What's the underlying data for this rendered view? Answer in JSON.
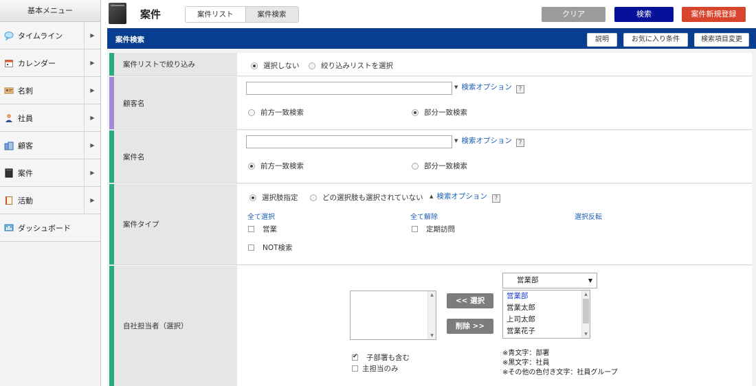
{
  "sidebar": {
    "header": "基本メニュー",
    "items": [
      {
        "label": "タイムライン",
        "icon": "speech-bubble-icon",
        "has_arrow": true
      },
      {
        "label": "カレンダー",
        "icon": "calendar-icon",
        "has_arrow": true
      },
      {
        "label": "名刺",
        "icon": "business-card-icon",
        "has_arrow": true
      },
      {
        "label": "社員",
        "icon": "person-icon",
        "has_arrow": true
      },
      {
        "label": "顧客",
        "icon": "building-icon",
        "has_arrow": true
      },
      {
        "label": "案件",
        "icon": "case-icon",
        "has_arrow": true
      },
      {
        "label": "活動",
        "icon": "notebook-icon",
        "has_arrow": true
      },
      {
        "label": "ダッシュボード",
        "icon": "dashboard-icon",
        "has_arrow": false
      }
    ],
    "arrow_glyph": "▶"
  },
  "header": {
    "title": "案件",
    "tabs": [
      {
        "label": "案件リスト",
        "active": false
      },
      {
        "label": "案件検索",
        "active": true
      }
    ],
    "buttons": {
      "clear": "クリア",
      "search": "検索",
      "new": "案件新規登録"
    },
    "colors": {
      "clear": "#9c9c9c",
      "search": "#06119a",
      "new": "#d9442c"
    }
  },
  "bar": {
    "title": "案件検索",
    "help": "説明",
    "favorite": "お気に入り条件",
    "change": "検索項目変更",
    "color": "#083e8f"
  },
  "form": {
    "list_filter": {
      "label": "案件リストで絞り込み",
      "options": [
        "選択しない",
        "絞り込みリストを選択"
      ],
      "selected": 0
    },
    "customer": {
      "label": "顧客名",
      "value": "",
      "option_link": "検索オプション",
      "match_options": [
        "前方一致検索",
        "部分一致検索"
      ],
      "selected": 1
    },
    "case_name": {
      "label": "案件名",
      "value": "",
      "option_link": "検索オプション",
      "match_options": [
        "前方一致検索",
        "部分一致検索"
      ],
      "selected": 0
    },
    "case_type": {
      "label": "案件タイプ",
      "modes": [
        "選択肢指定",
        "どの選択肢も選択されていない"
      ],
      "selected": 0,
      "option_link": "検索オプション",
      "select_all": "全て選択",
      "deselect_all": "全て解除",
      "invert": "選択反転",
      "choices": [
        "営業",
        "定期訪問"
      ],
      "not_search": "NOT検索"
    },
    "owner": {
      "label": "自社担当者（選択）",
      "select_btn": "<< 選択",
      "remove_btn": "削除 >>",
      "dept_select": "営業部",
      "options": [
        {
          "label": "営業部",
          "type": "dept"
        },
        {
          "label": "営業太郎",
          "type": "user"
        },
        {
          "label": "上司太郎",
          "type": "user"
        },
        {
          "label": "営業花子",
          "type": "user"
        }
      ],
      "include_sub": "子部署も含む",
      "include_sub_checked": true,
      "main_only": "主担当のみ",
      "main_only_checked": false,
      "notes": [
        "※青文字：部署",
        "※黒文字：社員",
        "※その他の色付き文字：社員グループ"
      ]
    }
  },
  "accent_colors": {
    "green": "#2aab80",
    "purple": "#a08bd8"
  },
  "help_glyph": "?"
}
